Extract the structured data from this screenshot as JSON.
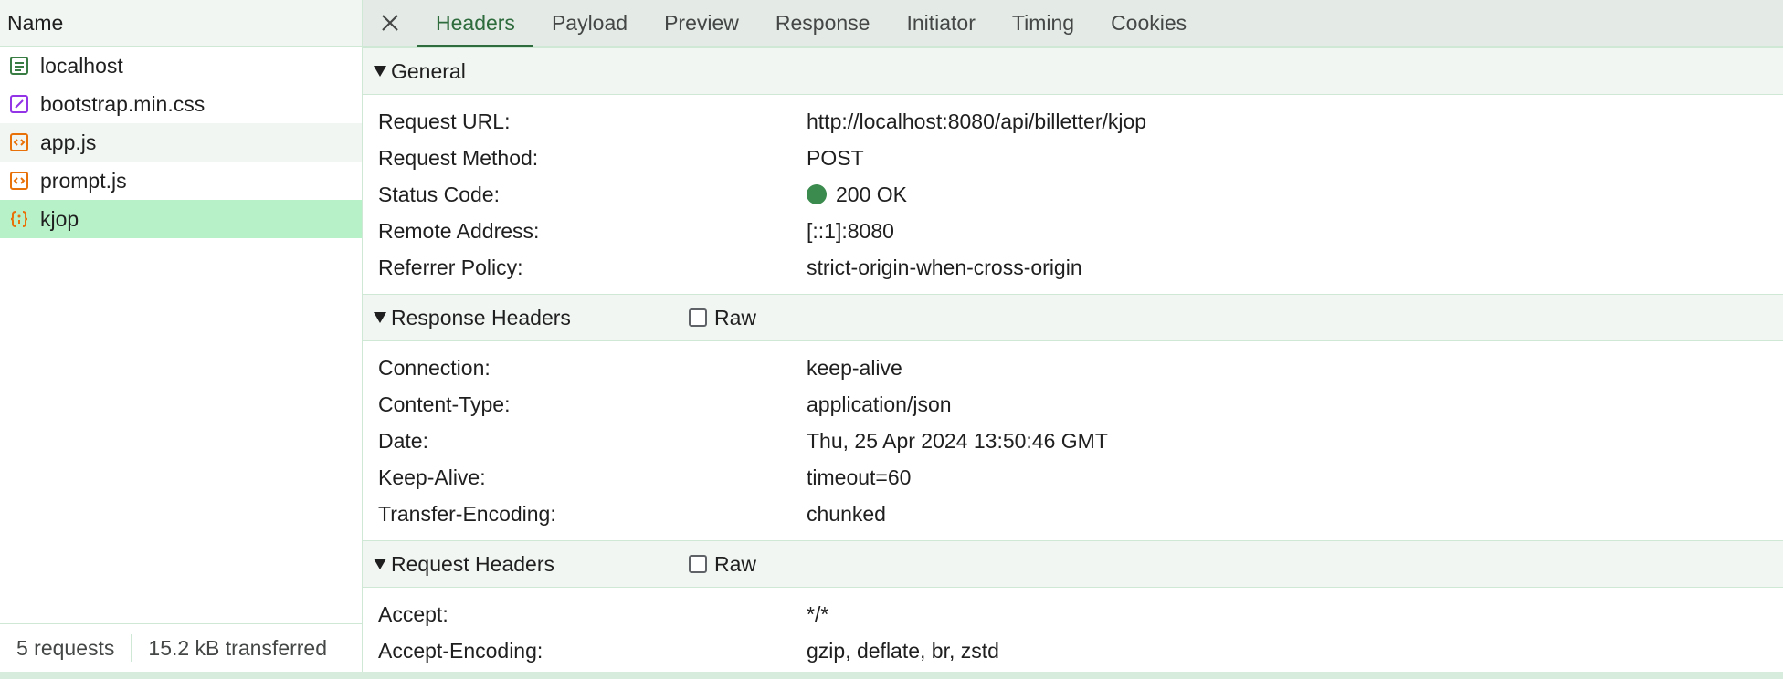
{
  "requests_panel": {
    "header": "Name",
    "items": [
      {
        "name": "localhost",
        "icon": "document-icon",
        "color": "#3a7d44"
      },
      {
        "name": "bootstrap.min.css",
        "icon": "stylesheet-icon",
        "color": "#9334e6"
      },
      {
        "name": "app.js",
        "icon": "script-icon",
        "color": "#e8710a"
      },
      {
        "name": "prompt.js",
        "icon": "script-icon",
        "color": "#e8710a"
      },
      {
        "name": "kjop",
        "icon": "json-icon",
        "color": "#e8710a"
      }
    ],
    "footer": {
      "requests": "5 requests",
      "transferred": "15.2 kB transferred"
    }
  },
  "tabs": {
    "items": [
      "Headers",
      "Payload",
      "Preview",
      "Response",
      "Initiator",
      "Timing",
      "Cookies"
    ],
    "active": "Headers"
  },
  "general": {
    "title": "General",
    "rows": [
      {
        "key": "Request URL:",
        "value": "http://localhost:8080/api/billetter/kjop"
      },
      {
        "key": "Request Method:",
        "value": "POST"
      },
      {
        "key": "Status Code:",
        "value": "200 OK"
      },
      {
        "key": "Remote Address:",
        "value": "[::1]:8080"
      },
      {
        "key": "Referrer Policy:",
        "value": "strict-origin-when-cross-origin"
      }
    ]
  },
  "response_headers": {
    "title": "Response Headers",
    "raw_label": "Raw",
    "rows": [
      {
        "key": "Connection:",
        "value": "keep-alive"
      },
      {
        "key": "Content-Type:",
        "value": "application/json"
      },
      {
        "key": "Date:",
        "value": "Thu, 25 Apr 2024 13:50:46 GMT"
      },
      {
        "key": "Keep-Alive:",
        "value": "timeout=60"
      },
      {
        "key": "Transfer-Encoding:",
        "value": "chunked"
      }
    ]
  },
  "request_headers": {
    "title": "Request Headers",
    "raw_label": "Raw",
    "rows": [
      {
        "key": "Accept:",
        "value": "*/*"
      },
      {
        "key": "Accept-Encoding:",
        "value": "gzip, deflate, br, zstd"
      }
    ]
  },
  "colors": {
    "accent": "#2e6b3d",
    "selected_row": "#b6f1c7",
    "status_ok": "#3a8b4d"
  }
}
